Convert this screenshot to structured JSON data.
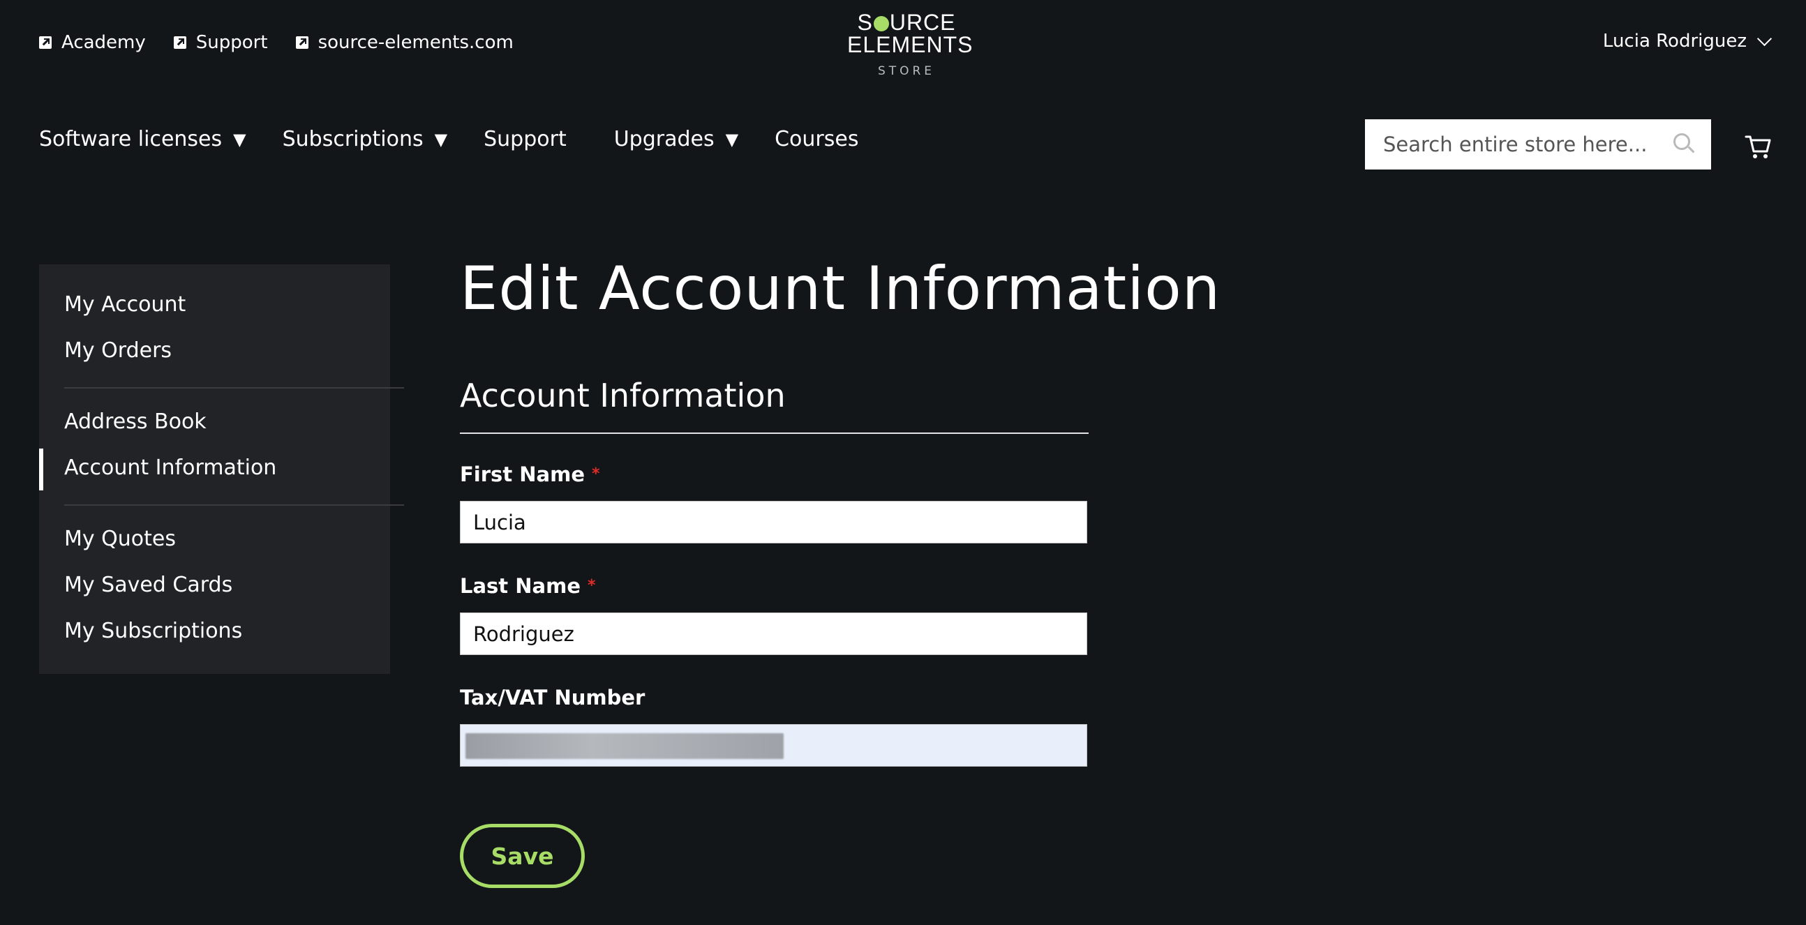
{
  "header": {
    "util_links": [
      {
        "label": "Academy",
        "icon": "external-link-icon"
      },
      {
        "label": "Support",
        "icon": "external-link-icon"
      },
      {
        "label": "source-elements.com",
        "icon": "external-link-icon"
      }
    ],
    "logo": {
      "line1_start": "S",
      "line1_end": "URCE",
      "line2": "ELEMENTS",
      "line3": "STORE",
      "dot_color": "#a7dc66"
    },
    "user_name": "Lucia Rodriguez"
  },
  "nav": {
    "items": [
      {
        "label": "Software licenses",
        "caret": "▼"
      },
      {
        "label": "Subscriptions",
        "caret": "▼"
      },
      {
        "label": "Support",
        "caret": ""
      },
      {
        "label": "Upgrades",
        "caret": "▼"
      },
      {
        "label": "Courses",
        "caret": ""
      }
    ],
    "search_placeholder": "Search entire store here..."
  },
  "sidebar": {
    "items": [
      {
        "label": "My Account"
      },
      {
        "label": "My Orders"
      },
      {
        "label": "Address Book"
      },
      {
        "label": "Account Information",
        "active": true
      },
      {
        "label": "My Quotes"
      },
      {
        "label": "My Saved Cards"
      },
      {
        "label": "My Subscriptions"
      }
    ]
  },
  "main": {
    "page_title": "Edit Account Information",
    "section_title": "Account Information",
    "fields": {
      "first_name": {
        "label": "First Name",
        "required_mark": "*",
        "value": "Lucia"
      },
      "last_name": {
        "label": "Last Name",
        "required_mark": "*",
        "value": "Rodriguez"
      },
      "tax_vat": {
        "label": "Tax/VAT Number",
        "value": ""
      }
    },
    "save_label": "Save"
  },
  "colors": {
    "background": "#131619",
    "sidebar": "#222327",
    "accent": "#a7dc66",
    "required": "#e02b27"
  }
}
